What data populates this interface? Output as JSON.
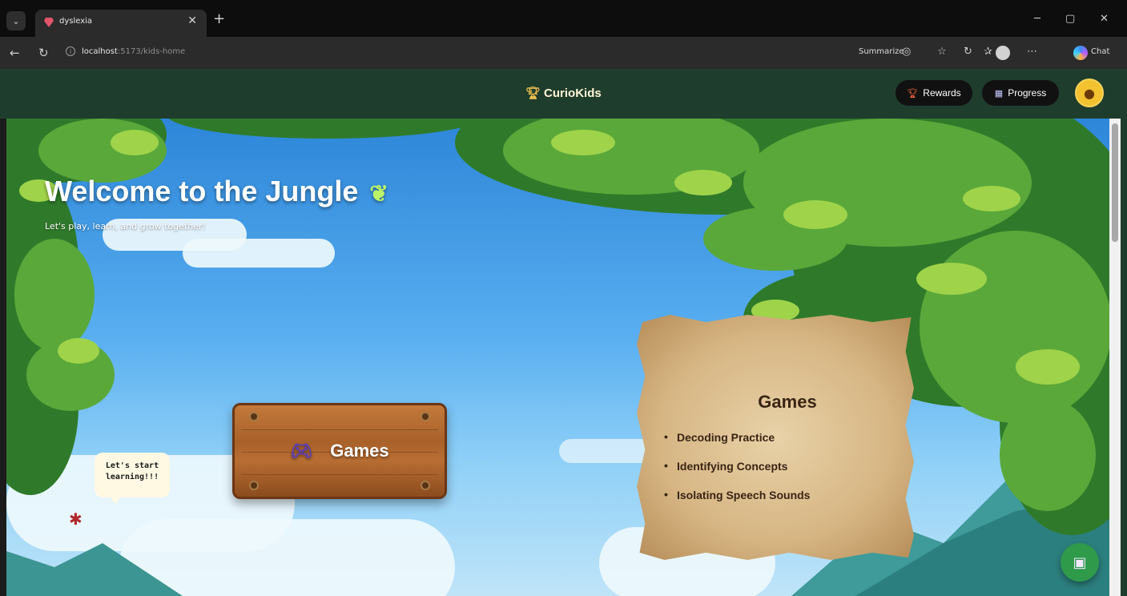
{
  "browser": {
    "tab_title": "dyslexia",
    "tab_close": "✕",
    "new_tab": "+",
    "tab_menu": "⌄",
    "url_host": "localhost",
    "url_rest": ":5173/kids-home",
    "summarize_label": "Summarize",
    "chat_label": "Chat",
    "window_controls": {
      "minimize": "─",
      "maximize": "▢",
      "close": "✕"
    }
  },
  "header": {
    "brand": "CurioKids",
    "brand_icon": "trophy-icon",
    "rewards_label": "Rewards",
    "progress_label": "Progress"
  },
  "hero": {
    "title": "Welcome to the Jungle",
    "subtitle": "Let's play, learn, and grow together!"
  },
  "sign": {
    "label": "Games"
  },
  "speech_bubble": {
    "line1": "Let's start",
    "line2": "learning!!!"
  },
  "scroll_card": {
    "title": "Games",
    "items": [
      "Decoding Practice",
      "Identifying Concepts",
      "Isolating Speech Sounds"
    ]
  },
  "colors": {
    "header_bg": "#1f3d2d",
    "fab_bg": "#2e9a4a",
    "avatar_bg": "#f2c230"
  }
}
